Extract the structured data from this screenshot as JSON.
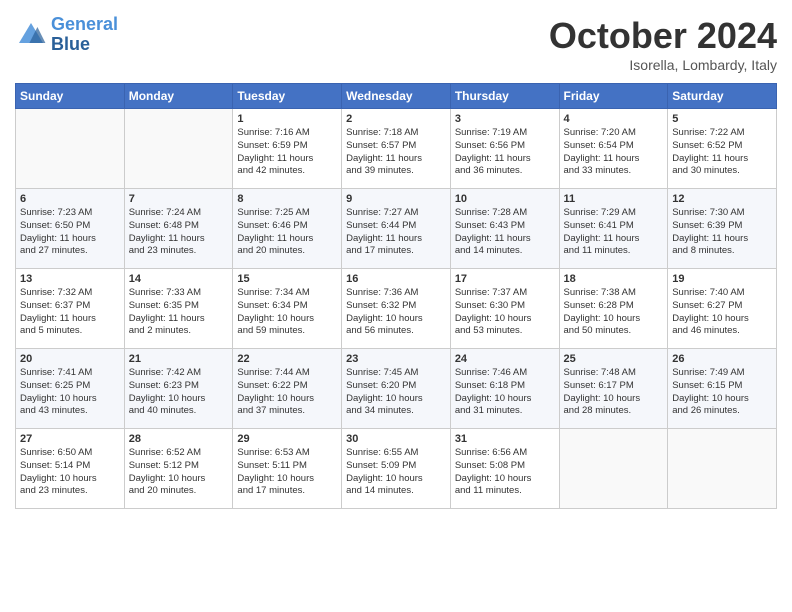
{
  "header": {
    "logo_line1": "General",
    "logo_line2": "Blue",
    "month": "October 2024",
    "location": "Isorella, Lombardy, Italy"
  },
  "weekdays": [
    "Sunday",
    "Monday",
    "Tuesday",
    "Wednesday",
    "Thursday",
    "Friday",
    "Saturday"
  ],
  "weeks": [
    [
      {
        "day": "",
        "content": ""
      },
      {
        "day": "",
        "content": ""
      },
      {
        "day": "1",
        "content": "Sunrise: 7:16 AM\nSunset: 6:59 PM\nDaylight: 11 hours\nand 42 minutes."
      },
      {
        "day": "2",
        "content": "Sunrise: 7:18 AM\nSunset: 6:57 PM\nDaylight: 11 hours\nand 39 minutes."
      },
      {
        "day": "3",
        "content": "Sunrise: 7:19 AM\nSunset: 6:56 PM\nDaylight: 11 hours\nand 36 minutes."
      },
      {
        "day": "4",
        "content": "Sunrise: 7:20 AM\nSunset: 6:54 PM\nDaylight: 11 hours\nand 33 minutes."
      },
      {
        "day": "5",
        "content": "Sunrise: 7:22 AM\nSunset: 6:52 PM\nDaylight: 11 hours\nand 30 minutes."
      }
    ],
    [
      {
        "day": "6",
        "content": "Sunrise: 7:23 AM\nSunset: 6:50 PM\nDaylight: 11 hours\nand 27 minutes."
      },
      {
        "day": "7",
        "content": "Sunrise: 7:24 AM\nSunset: 6:48 PM\nDaylight: 11 hours\nand 23 minutes."
      },
      {
        "day": "8",
        "content": "Sunrise: 7:25 AM\nSunset: 6:46 PM\nDaylight: 11 hours\nand 20 minutes."
      },
      {
        "day": "9",
        "content": "Sunrise: 7:27 AM\nSunset: 6:44 PM\nDaylight: 11 hours\nand 17 minutes."
      },
      {
        "day": "10",
        "content": "Sunrise: 7:28 AM\nSunset: 6:43 PM\nDaylight: 11 hours\nand 14 minutes."
      },
      {
        "day": "11",
        "content": "Sunrise: 7:29 AM\nSunset: 6:41 PM\nDaylight: 11 hours\nand 11 minutes."
      },
      {
        "day": "12",
        "content": "Sunrise: 7:30 AM\nSunset: 6:39 PM\nDaylight: 11 hours\nand 8 minutes."
      }
    ],
    [
      {
        "day": "13",
        "content": "Sunrise: 7:32 AM\nSunset: 6:37 PM\nDaylight: 11 hours\nand 5 minutes."
      },
      {
        "day": "14",
        "content": "Sunrise: 7:33 AM\nSunset: 6:35 PM\nDaylight: 11 hours\nand 2 minutes."
      },
      {
        "day": "15",
        "content": "Sunrise: 7:34 AM\nSunset: 6:34 PM\nDaylight: 10 hours\nand 59 minutes."
      },
      {
        "day": "16",
        "content": "Sunrise: 7:36 AM\nSunset: 6:32 PM\nDaylight: 10 hours\nand 56 minutes."
      },
      {
        "day": "17",
        "content": "Sunrise: 7:37 AM\nSunset: 6:30 PM\nDaylight: 10 hours\nand 53 minutes."
      },
      {
        "day": "18",
        "content": "Sunrise: 7:38 AM\nSunset: 6:28 PM\nDaylight: 10 hours\nand 50 minutes."
      },
      {
        "day": "19",
        "content": "Sunrise: 7:40 AM\nSunset: 6:27 PM\nDaylight: 10 hours\nand 46 minutes."
      }
    ],
    [
      {
        "day": "20",
        "content": "Sunrise: 7:41 AM\nSunset: 6:25 PM\nDaylight: 10 hours\nand 43 minutes."
      },
      {
        "day": "21",
        "content": "Sunrise: 7:42 AM\nSunset: 6:23 PM\nDaylight: 10 hours\nand 40 minutes."
      },
      {
        "day": "22",
        "content": "Sunrise: 7:44 AM\nSunset: 6:22 PM\nDaylight: 10 hours\nand 37 minutes."
      },
      {
        "day": "23",
        "content": "Sunrise: 7:45 AM\nSunset: 6:20 PM\nDaylight: 10 hours\nand 34 minutes."
      },
      {
        "day": "24",
        "content": "Sunrise: 7:46 AM\nSunset: 6:18 PM\nDaylight: 10 hours\nand 31 minutes."
      },
      {
        "day": "25",
        "content": "Sunrise: 7:48 AM\nSunset: 6:17 PM\nDaylight: 10 hours\nand 28 minutes."
      },
      {
        "day": "26",
        "content": "Sunrise: 7:49 AM\nSunset: 6:15 PM\nDaylight: 10 hours\nand 26 minutes."
      }
    ],
    [
      {
        "day": "27",
        "content": "Sunrise: 6:50 AM\nSunset: 5:14 PM\nDaylight: 10 hours\nand 23 minutes."
      },
      {
        "day": "28",
        "content": "Sunrise: 6:52 AM\nSunset: 5:12 PM\nDaylight: 10 hours\nand 20 minutes."
      },
      {
        "day": "29",
        "content": "Sunrise: 6:53 AM\nSunset: 5:11 PM\nDaylight: 10 hours\nand 17 minutes."
      },
      {
        "day": "30",
        "content": "Sunrise: 6:55 AM\nSunset: 5:09 PM\nDaylight: 10 hours\nand 14 minutes."
      },
      {
        "day": "31",
        "content": "Sunrise: 6:56 AM\nSunset: 5:08 PM\nDaylight: 10 hours\nand 11 minutes."
      },
      {
        "day": "",
        "content": ""
      },
      {
        "day": "",
        "content": ""
      }
    ]
  ]
}
